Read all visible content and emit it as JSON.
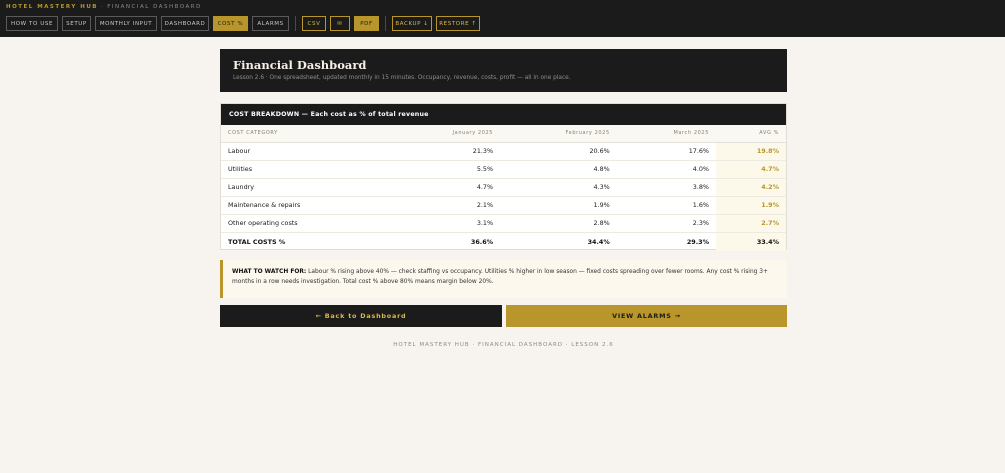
{
  "brand": {
    "name": "HOTEL MASTERY HUB",
    "separator": "·",
    "section": "FINANCIAL DASHBOARD"
  },
  "nav": {
    "items": [
      {
        "label": "HOW TO USE",
        "width": 52
      },
      {
        "label": "SETUP",
        "width": 29
      },
      {
        "label": "MONTHLY INPUT",
        "width": 62
      },
      {
        "label": "DASHBOARD",
        "width": 48
      },
      {
        "label": "COST %",
        "width": 35
      },
      {
        "label": "ALARMS",
        "width": 37
      }
    ],
    "csv_label": "CSV",
    "mail_icon": "✉",
    "pdf_label": "PDF",
    "backup_label": "BACKUP ↓",
    "restore_label": "RESTORE ↑"
  },
  "hero": {
    "title": "Financial Dashboard",
    "subtitle": "Lesson 2.6 · One spreadsheet, updated monthly in 15 minutes. Occupancy, revenue, costs, profit — all in one place."
  },
  "breakdown": {
    "heading": "COST BREAKDOWN — Each cost as % of total revenue",
    "columns": [
      "COST CATEGORY",
      "January 2025",
      "February 2025",
      "March 2025",
      "AVG %"
    ],
    "rows": [
      {
        "category": "Labour",
        "jan": "21.3%",
        "feb": "20.6%",
        "mar": "17.6%",
        "avg": "19.8%"
      },
      {
        "category": "Utilities",
        "jan": "5.5%",
        "feb": "4.8%",
        "mar": "4.0%",
        "avg": "4.7%"
      },
      {
        "category": "Laundry",
        "jan": "4.7%",
        "feb": "4.3%",
        "mar": "3.8%",
        "avg": "4.2%"
      },
      {
        "category": "Maintenance & repairs",
        "jan": "2.1%",
        "feb": "1.9%",
        "mar": "1.6%",
        "avg": "1.9%"
      },
      {
        "category": "Other operating costs",
        "jan": "3.1%",
        "feb": "2.8%",
        "mar": "2.3%",
        "avg": "2.7%"
      }
    ],
    "total": {
      "category": "TOTAL COSTS %",
      "jan": "36.6%",
      "feb": "34.4%",
      "mar": "29.3%",
      "avg": "33.4%"
    }
  },
  "watch": {
    "label": "WHAT TO WATCH FOR:",
    "text": " Labour % rising above 40% — check staffing vs occupancy. Utilities % higher in low season — fixed costs spreading over fewer rooms. Any cost % rising 3+ months in a row needs investigation. Total cost % above 80% means margin below 20%."
  },
  "actions": {
    "back_label": "← Back to Dashboard",
    "alarms_label": "VIEW ALARMS →"
  },
  "footer": {
    "text": "HOTEL MASTERY HUB · FINANCIAL DASHBOARD · LESSON 2.6"
  },
  "colors": {
    "dark": "#1b1b1b",
    "gold": "#b8962b",
    "background": "#f7f4ef"
  }
}
